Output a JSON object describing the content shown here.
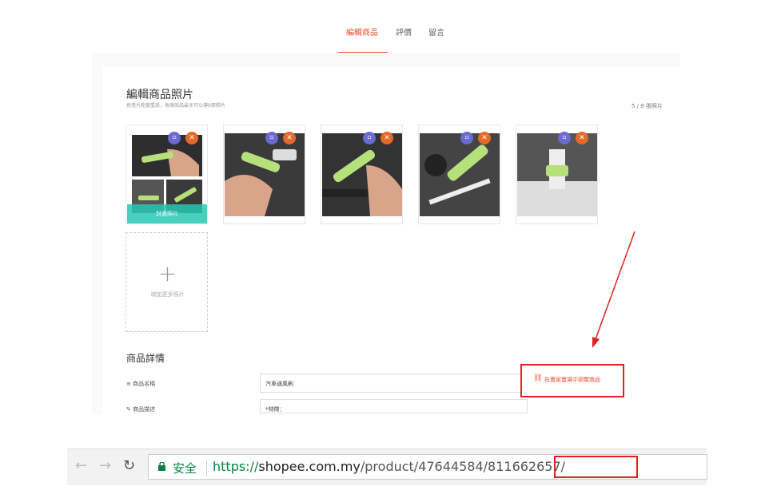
{
  "tabs": [
    {
      "label": "編輯商品",
      "active": true
    },
    {
      "label": "評價",
      "active": false
    },
    {
      "label": "留言",
      "active": false
    }
  ],
  "photos_section": {
    "title": "編輯商品照片",
    "subtitle": "拖曳片能變重設，每個商品最多可以傳9張照片",
    "count": "5 / 9 張照片",
    "cover_label": "封面照片",
    "add_label": "增加更多照片",
    "add_symbol": "+"
  },
  "details_section": {
    "title": "商品詳情",
    "fields": [
      {
        "label": "商品名稱",
        "value": "汽車通風刷"
      },
      {
        "label": "商品描述",
        "value": "*特徵："
      }
    ]
  },
  "view_in_shop_link": "在賣家賣場中瀏覽商品",
  "browser": {
    "secure_text": "安全",
    "url_scheme": "https://",
    "url_host": "shopee.com.my",
    "url_path": "/product/47644584",
    "url_highlight": "/811662657/"
  },
  "colors": {
    "accent": "#ee4d2d",
    "annotation": "#e02020",
    "secure": "#0b8043"
  }
}
